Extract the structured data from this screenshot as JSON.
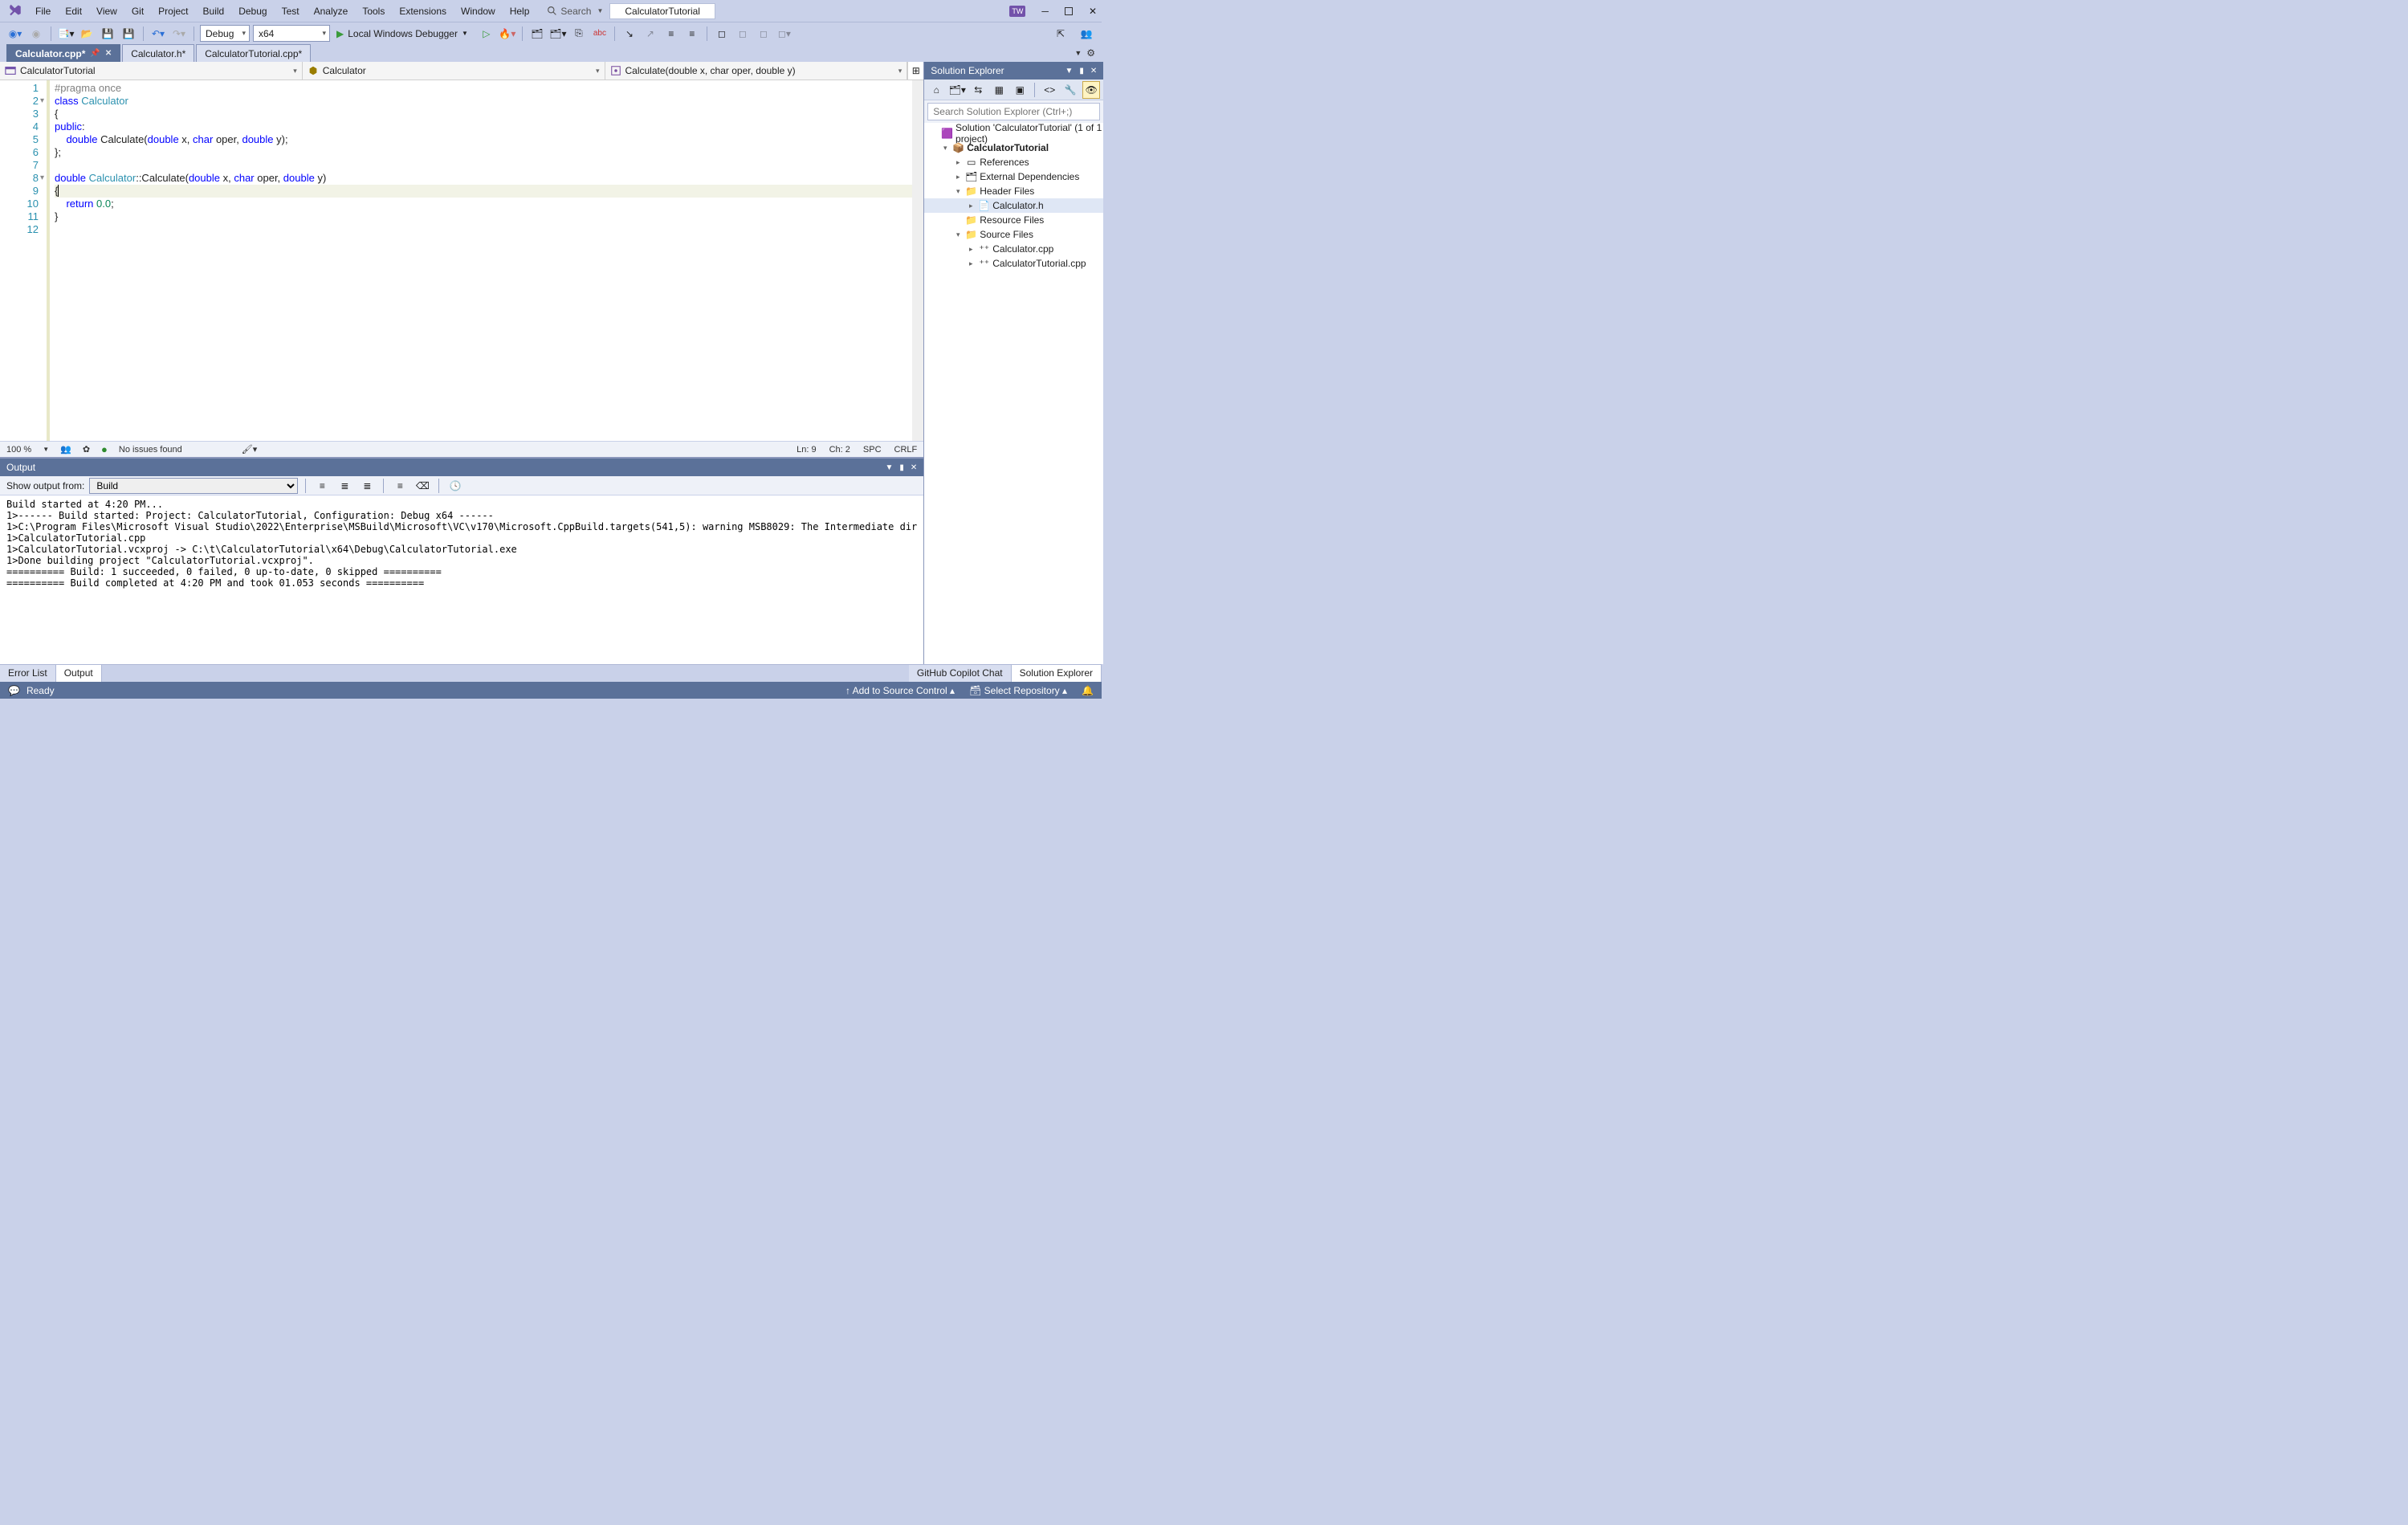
{
  "menu": {
    "items": [
      "File",
      "Edit",
      "View",
      "Git",
      "Project",
      "Build",
      "Debug",
      "Test",
      "Analyze",
      "Tools",
      "Extensions",
      "Window",
      "Help"
    ],
    "search": "Search"
  },
  "title_solution": "CalculatorTutorial",
  "toolbar": {
    "config": "Debug",
    "platform": "x64",
    "debugger": "Local Windows Debugger"
  },
  "tabs": [
    {
      "label": "Calculator.cpp*",
      "active": true,
      "pinned": true
    },
    {
      "label": "Calculator.h*",
      "active": false
    },
    {
      "label": "CalculatorTutorial.cpp*",
      "active": false
    }
  ],
  "nav": {
    "scope": "CalculatorTutorial",
    "class": "Calculator",
    "member": "Calculate(double x, char oper, double y)"
  },
  "code": {
    "lines": [
      {
        "n": 1,
        "html": "<span class='k-pp'>#pragma once</span>"
      },
      {
        "n": 2,
        "html": "<span class='k-kw'>class</span> <span class='k-ty'>Calculator</span>",
        "fold": true
      },
      {
        "n": 3,
        "html": "{"
      },
      {
        "n": 4,
        "html": "<span class='k-kw'>public</span>:"
      },
      {
        "n": 5,
        "html": "    <span class='k-kw'>double</span> Calculate(<span class='k-kw'>double</span> x, <span class='k-kw'>char</span> oper, <span class='k-kw'>double</span> y);"
      },
      {
        "n": 6,
        "html": "};"
      },
      {
        "n": 7,
        "html": ""
      },
      {
        "n": 8,
        "html": "<span class='k-kw'>double</span> <span class='k-ty'>Calculator</span>::Calculate(<span class='k-kw'>double</span> x, <span class='k-kw'>char</span> oper, <span class='k-kw'>double</span> y)",
        "fold": true
      },
      {
        "n": 9,
        "html": "{|",
        "hl": true
      },
      {
        "n": 10,
        "html": "    <span class='k-kw'>return</span> <span class='k-lit'>0.0</span>;"
      },
      {
        "n": 11,
        "html": "}"
      },
      {
        "n": 12,
        "html": ""
      }
    ]
  },
  "editor_status": {
    "zoom": "100 %",
    "issues": "No issues found",
    "ln": "Ln: 9",
    "ch": "Ch: 2",
    "spc": "SPC",
    "eol": "CRLF"
  },
  "solex": {
    "title": "Solution Explorer",
    "search_placeholder": "Search Solution Explorer (Ctrl+;)",
    "tree": [
      {
        "lvl": 0,
        "tw": "",
        "icon": "sol",
        "label": "Solution 'CalculatorTutorial' (1 of 1 project)"
      },
      {
        "lvl": 1,
        "tw": "▾",
        "icon": "proj",
        "label": "CalculatorTutorial",
        "bold": true
      },
      {
        "lvl": 2,
        "tw": "▸",
        "icon": "ref",
        "label": "References"
      },
      {
        "lvl": 2,
        "tw": "▸",
        "icon": "ext",
        "label": "External Dependencies"
      },
      {
        "lvl": 2,
        "tw": "▾",
        "icon": "fld",
        "label": "Header Files"
      },
      {
        "lvl": 3,
        "tw": "▸",
        "icon": "h",
        "label": "Calculator.h",
        "sel": true
      },
      {
        "lvl": 2,
        "tw": "",
        "icon": "fld",
        "label": "Resource Files"
      },
      {
        "lvl": 2,
        "tw": "▾",
        "icon": "fld",
        "label": "Source Files"
      },
      {
        "lvl": 3,
        "tw": "▸",
        "icon": "cpp",
        "label": "Calculator.cpp"
      },
      {
        "lvl": 3,
        "tw": "▸",
        "icon": "cpp",
        "label": "CalculatorTutorial.cpp"
      }
    ]
  },
  "output": {
    "title": "Output",
    "from_label": "Show output from:",
    "from_value": "Build",
    "body": "Build started at 4:20 PM...\n1>------ Build started: Project: CalculatorTutorial, Configuration: Debug x64 ------\n1>C:\\Program Files\\Microsoft Visual Studio\\2022\\Enterprise\\MSBuild\\Microsoft\\VC\\v170\\Microsoft.CppBuild.targets(541,5): warning MSB8029: The Intermediate dir\n1>CalculatorTutorial.cpp\n1>CalculatorTutorial.vcxproj -> C:\\t\\CalculatorTutorial\\x64\\Debug\\CalculatorTutorial.exe\n1>Done building project \"CalculatorTutorial.vcxproj\".\n========== Build: 1 succeeded, 0 failed, 0 up-to-date, 0 skipped ==========\n========== Build completed at 4:20 PM and took 01.053 seconds =========="
  },
  "bottom_tabs": {
    "left": [
      "Error List",
      "Output"
    ],
    "right": [
      "GitHub Copilot Chat",
      "Solution Explorer"
    ],
    "active_left": "Output",
    "active_right": "Solution Explorer"
  },
  "status": {
    "ready": "Ready",
    "add_src": "Add to Source Control",
    "repo": "Select Repository"
  }
}
